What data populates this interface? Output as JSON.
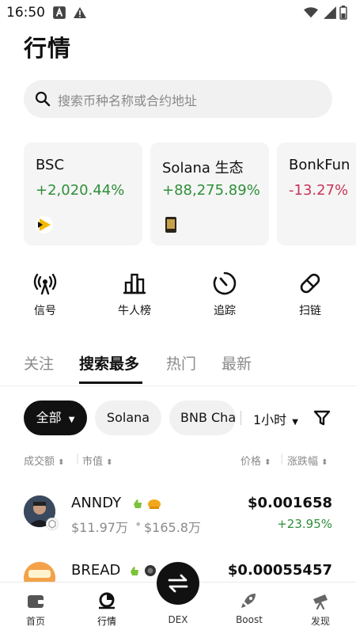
{
  "status": {
    "time": "16:50"
  },
  "page": {
    "title": "行情"
  },
  "search": {
    "placeholder": "搜索币种名称或合约地址"
  },
  "cards": [
    {
      "name": "BSC",
      "change": "+2,020.44%"
    },
    {
      "name": "Solana 生态",
      "change": "+88,275.89%"
    },
    {
      "name": "BonkFun",
      "change": "-13.27%"
    }
  ],
  "actions": [
    {
      "label": "信号",
      "icon": "signal-icon"
    },
    {
      "label": "牛人榜",
      "icon": "leaderboard-icon"
    },
    {
      "label": "追踪",
      "icon": "tracker-icon"
    },
    {
      "label": "扫链",
      "icon": "scan-chain-icon"
    }
  ],
  "tabs": [
    "关注",
    "搜索最多",
    "热门",
    "最新"
  ],
  "filters": {
    "all": "全部",
    "solana": "Solana",
    "bnb": "BNB Cha",
    "time": "1小时"
  },
  "sort": {
    "volume": "成交额",
    "mcap": "市值",
    "price": "价格",
    "change": "涨跌幅"
  },
  "tokens": [
    {
      "name": "ANNDY",
      "volume": "$11.97万",
      "mcap": "$165.8万",
      "price": "$0.001658",
      "change": "+23.95%"
    },
    {
      "name": "BREAD",
      "price": "$0.00055457"
    }
  ],
  "nav": [
    {
      "label": "首页"
    },
    {
      "label": "行情"
    },
    {
      "label": "DEX"
    },
    {
      "label": "Boost"
    },
    {
      "label": "发现"
    }
  ],
  "colors": {
    "positive": "#2f8f3a",
    "negative": "#c9345a",
    "primary": "#111111"
  }
}
